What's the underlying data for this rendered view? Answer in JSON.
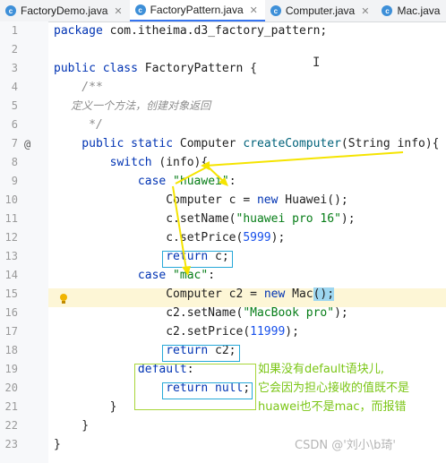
{
  "tabs": [
    {
      "label": "FactoryDemo.java",
      "active": false
    },
    {
      "label": "FactoryPattern.java",
      "active": true
    },
    {
      "label": "Computer.java",
      "active": false
    },
    {
      "label": "Mac.java",
      "active": false
    }
  ],
  "line_numbers": [
    "1",
    "2",
    "3",
    "4",
    "5",
    "6",
    "7",
    "8",
    "9",
    "10",
    "11",
    "12",
    "13",
    "14",
    "15",
    "16",
    "17",
    "18",
    "19",
    "20",
    "21",
    "22",
    "23"
  ],
  "code": {
    "l1_kw": "package",
    "l1_rest": " com.itheima.d3_factory_pattern;",
    "l3_kw": "public class",
    "l3_name": " FactoryPattern",
    "l3_rest": " {",
    "l4": "    /**",
    "l5": "     定义一个方法，创建对象返回",
    "l6": "     */",
    "l7_kw": "    public static",
    "l7_type": " Computer ",
    "l7_fn": "createComputer",
    "l7_rest": "(String info){",
    "l8_kw": "        switch",
    "l8_rest": " (info){",
    "l9_kw": "            case",
    "l9_str": " \"huawei\"",
    "l9_rest": ":",
    "l10_a": "                Computer c = ",
    "l10_kw": "new",
    "l10_b": " Huawei();",
    "l11_a": "                c.setName(",
    "l11_str": "\"huawei pro 16\"",
    "l11_b": ");",
    "l12_a": "                c.setPrice(",
    "l12_num": "5999",
    "l12_b": ");",
    "l13_kw": "return",
    "l13_rest": " c;",
    "l14_kw": "            case",
    "l14_str": " \"mac\"",
    "l14_rest": ":",
    "l15_a": "                Computer c2 = ",
    "l15_kw": "new",
    "l15_b": " Mac",
    "l15_c": "();",
    "l16_a": "                c2.setName(",
    "l16_str": "\"MacBook pro\"",
    "l16_b": ");",
    "l17_a": "                c2.setPrice(",
    "l17_num": "11999",
    "l17_b": ");",
    "l18_kw": "return",
    "l18_rest": " c2;",
    "l19_kw": "default",
    "l19_rest": ":",
    "l20_kw": "return null",
    "l20_rest": ";",
    "l21": "        }",
    "l22": "    }",
    "l23": "}"
  },
  "annotation": {
    "line1": "如果没有default语块儿,",
    "line2": "它会因为担心接收的值既不是",
    "line3": "huawei也不是mac，而报错"
  },
  "watermark": "CSDN @'刘小\\b琦'",
  "colors": {
    "keyword": "#0033b3",
    "string": "#067d17",
    "annotation": "#7bc616",
    "arrow": "#f5e400",
    "box": "#26a8d8"
  }
}
